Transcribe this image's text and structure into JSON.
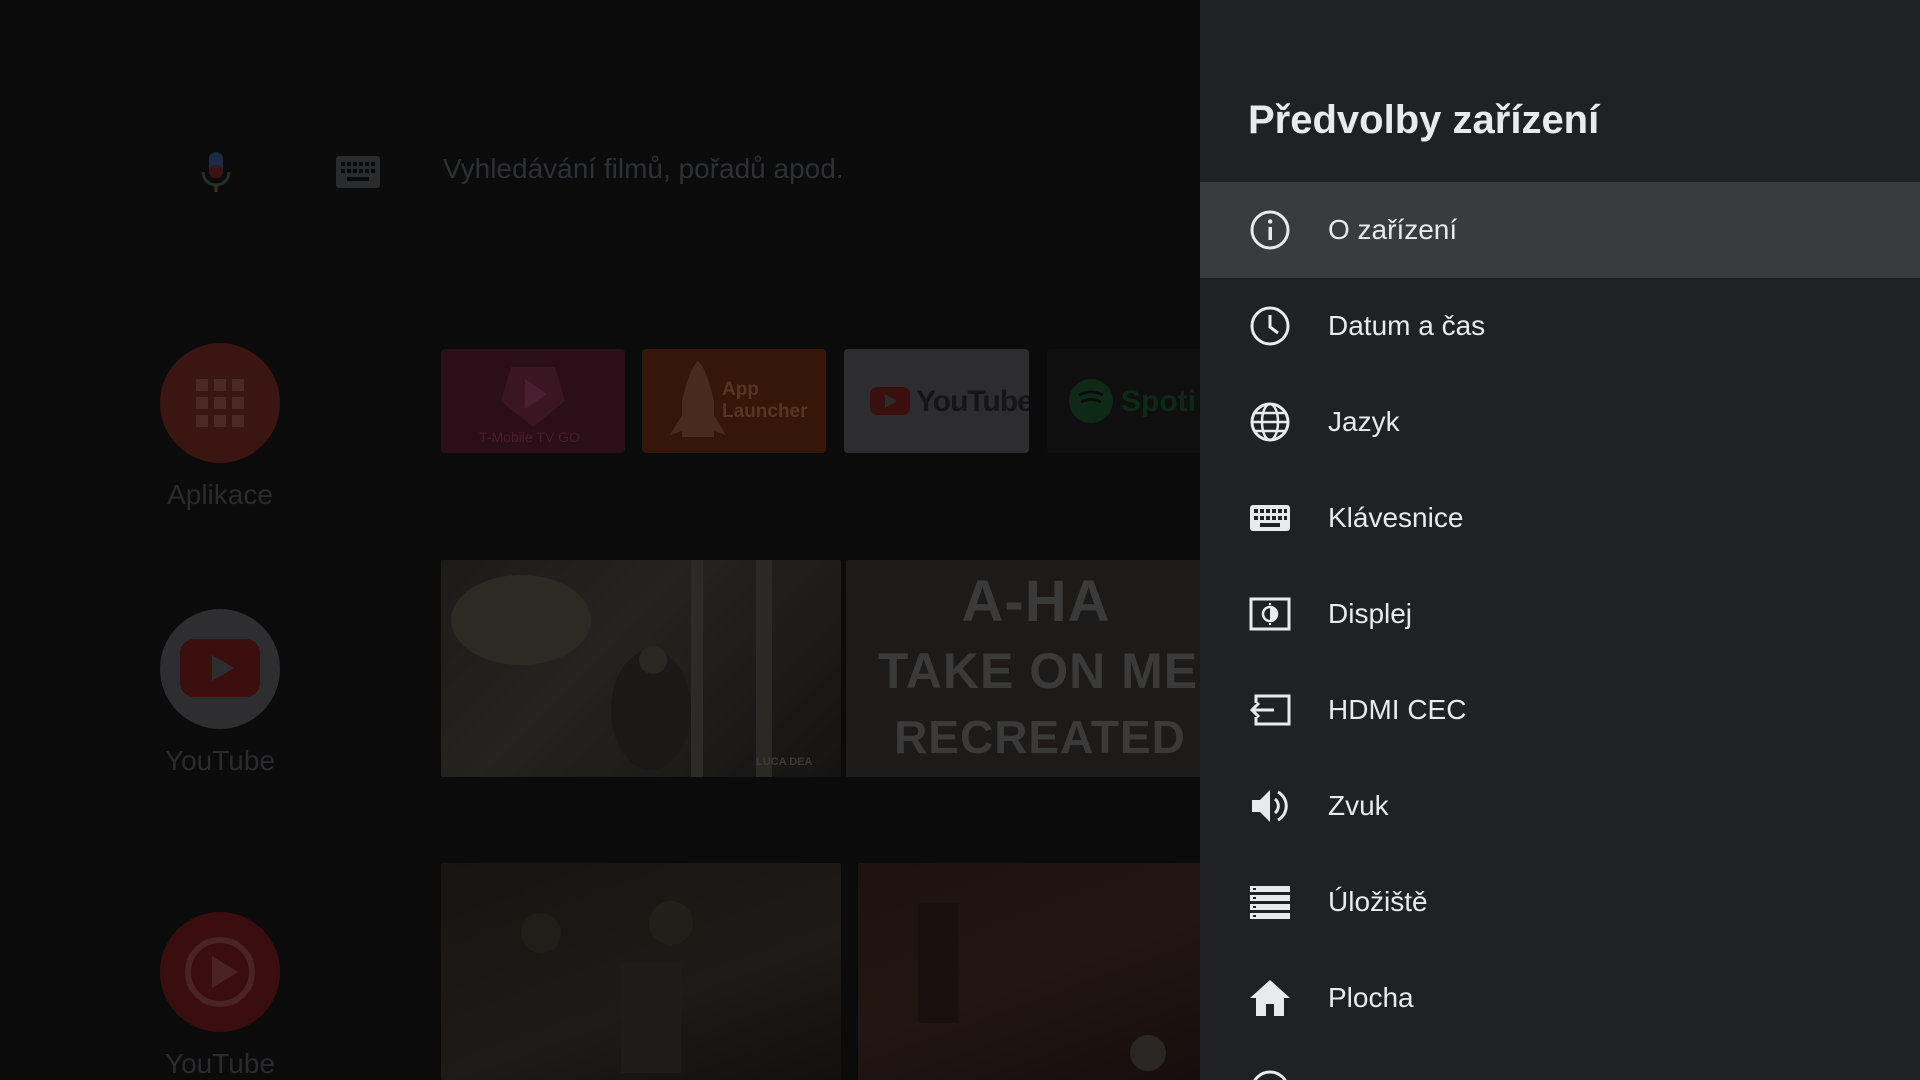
{
  "search": {
    "placeholder": "Vyhledávání filmů, pořadů apod."
  },
  "side_apps": [
    {
      "label": "Aplikace",
      "icon": "apps-grid-icon",
      "color": "#3a1511"
    },
    {
      "label": "YouTube",
      "icon": "youtube-icon",
      "color": "#3a3a3a"
    },
    {
      "label": "YouTube",
      "icon": "play-circle-icon",
      "color": "#3a0e0e"
    }
  ],
  "favorite_tiles": [
    {
      "name": "T-Mobile TV GO",
      "label": "T-Mobile TV GO"
    },
    {
      "name": "App Launcher",
      "label": "App Launcher"
    },
    {
      "name": "YouTube",
      "label": "YouTube"
    },
    {
      "name": "Spotify",
      "label": "Spoti"
    }
  ],
  "featured": {
    "title_lines": [
      "A-HA",
      "TAKE ON ME",
      "RECREATED"
    ],
    "credit": "LUCA DEA"
  },
  "settings_panel": {
    "title": "Předvolby zařízení",
    "items": [
      {
        "label": "O zařízení",
        "icon": "info-icon",
        "focused": true
      },
      {
        "label": "Datum a čas",
        "icon": "clock-icon",
        "focused": false
      },
      {
        "label": "Jazyk",
        "icon": "globe-icon",
        "focused": false
      },
      {
        "label": "Klávesnice",
        "icon": "keyboard-icon",
        "focused": false
      },
      {
        "label": "Displej",
        "icon": "display-icon",
        "focused": false
      },
      {
        "label": "HDMI CEC",
        "icon": "input-icon",
        "focused": false
      },
      {
        "label": "Zvuk",
        "icon": "volume-icon",
        "focused": false
      },
      {
        "label": "Úložiště",
        "icon": "storage-icon",
        "focused": false
      },
      {
        "label": "Plocha",
        "icon": "home-icon",
        "focused": false
      }
    ]
  },
  "colors": {
    "panel_bg": "#202124",
    "focus_bg": "#3a3b3e",
    "text": "#e8eaed"
  }
}
